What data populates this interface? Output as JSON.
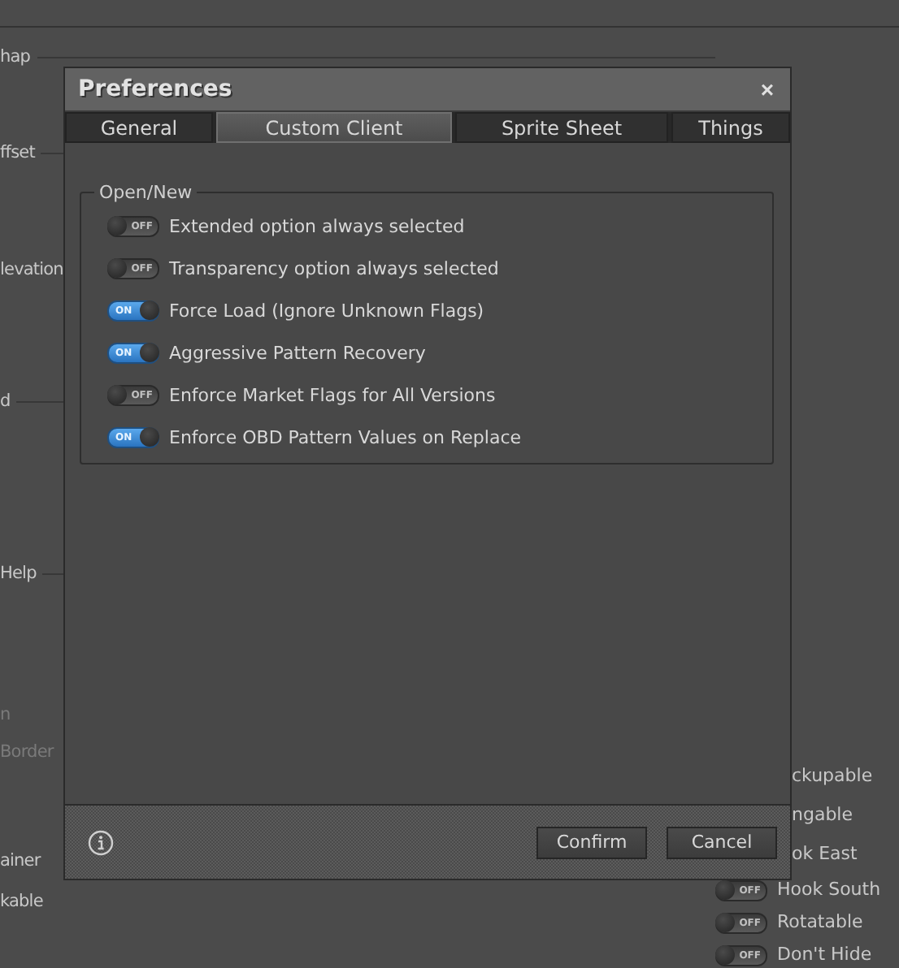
{
  "background": {
    "left_labels": [
      {
        "text": "hap",
        "kind": "legend"
      },
      {
        "text": "ffset",
        "kind": "legend"
      },
      {
        "text": "levation",
        "kind": "legend"
      },
      {
        "text": "d",
        "kind": "legend"
      },
      {
        "text": "Help",
        "kind": "legend"
      },
      {
        "text": "n",
        "kind": "dim"
      },
      {
        "text": "Border",
        "kind": "dim"
      },
      {
        "text": "ainer",
        "kind": "label"
      },
      {
        "text": "kable",
        "kind": "label"
      }
    ],
    "right_options": [
      {
        "label": "ckupable",
        "kind": "cut"
      },
      {
        "label": "ngable",
        "kind": "cut"
      },
      {
        "label": "ok East",
        "kind": "cut"
      },
      {
        "label": "Hook South",
        "kind": "toggle",
        "on": false,
        "switch_text": "OFF"
      },
      {
        "label": "Rotatable",
        "kind": "toggle",
        "on": false,
        "switch_text": "OFF"
      },
      {
        "label": "Don't Hide",
        "kind": "toggle",
        "on": false,
        "switch_text": "OFF"
      }
    ]
  },
  "dialog": {
    "title": "Preferences",
    "close": "×",
    "tabs": [
      {
        "label": "General",
        "selected": false
      },
      {
        "label": "Custom Client",
        "selected": true
      },
      {
        "label": "Sprite Sheet",
        "selected": false
      },
      {
        "label": "Things",
        "selected": false
      }
    ],
    "group": {
      "legend": "Open/New",
      "options": [
        {
          "label": "Extended option always selected",
          "on": false,
          "switch_text": "OFF"
        },
        {
          "label": "Transparency option always selected",
          "on": false,
          "switch_text": "OFF"
        },
        {
          "label": "Force Load (Ignore Unknown Flags)",
          "on": true,
          "switch_text": "ON"
        },
        {
          "label": "Aggressive Pattern Recovery",
          "on": true,
          "switch_text": "ON"
        },
        {
          "label": "Enforce Market Flags for All Versions",
          "on": false,
          "switch_text": "OFF"
        },
        {
          "label": "Enforce OBD Pattern Values on Replace",
          "on": true,
          "switch_text": "ON"
        }
      ]
    },
    "buttons": [
      "Confirm",
      "Cancel"
    ]
  }
}
